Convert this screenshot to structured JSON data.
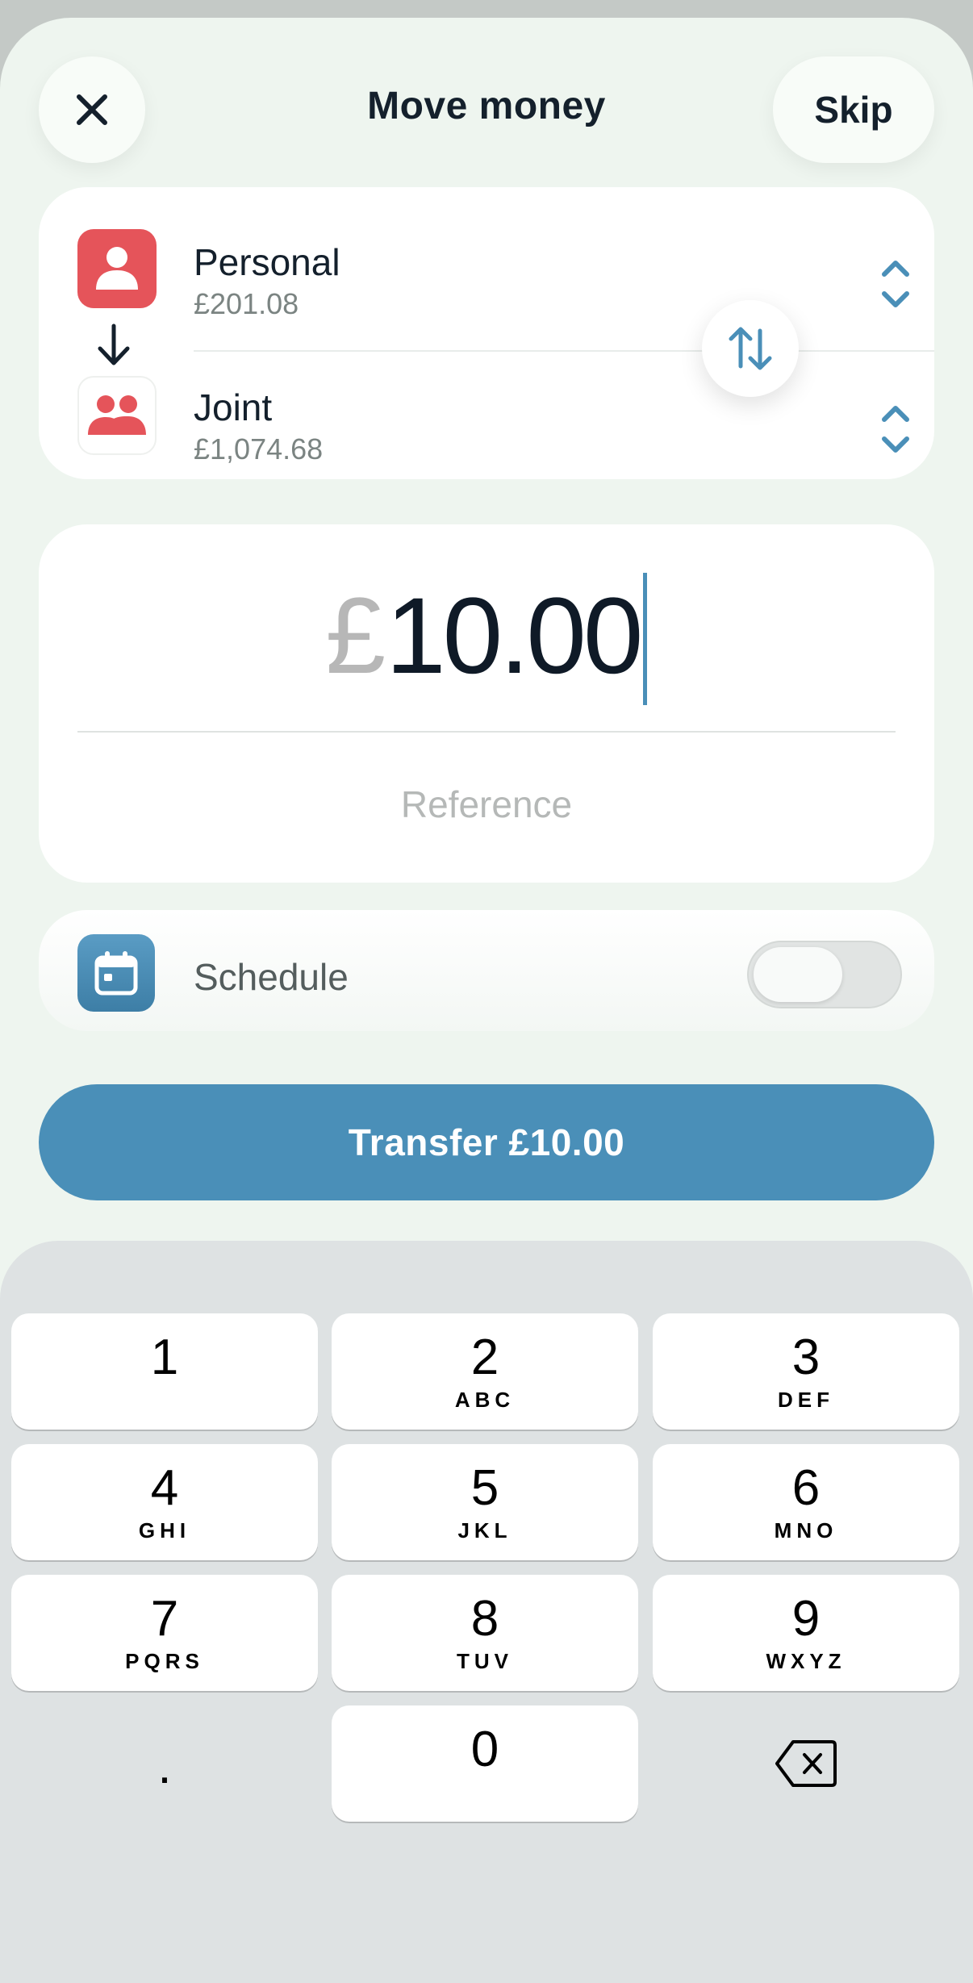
{
  "header": {
    "title": "Move money",
    "skip_label": "Skip",
    "close_icon": "close-icon"
  },
  "accounts": {
    "from": {
      "name": "Personal",
      "balance": "£201.08",
      "icon": "person-icon",
      "color": "#e5545a"
    },
    "to": {
      "name": "Joint",
      "balance": "£1,074.68",
      "icon": "people-icon",
      "color": "#e5545a"
    }
  },
  "amount": {
    "currency": "£",
    "value": "10.00"
  },
  "reference": {
    "placeholder": "Reference"
  },
  "schedule": {
    "label": "Schedule",
    "enabled": false
  },
  "transfer": {
    "label": "Transfer £10.00"
  },
  "keypad": {
    "keys": [
      {
        "num": "1",
        "sub": ""
      },
      {
        "num": "2",
        "sub": "ABC"
      },
      {
        "num": "3",
        "sub": "DEF"
      },
      {
        "num": "4",
        "sub": "GHI"
      },
      {
        "num": "5",
        "sub": "JKL"
      },
      {
        "num": "6",
        "sub": "MNO"
      },
      {
        "num": "7",
        "sub": "PQRS"
      },
      {
        "num": "8",
        "sub": "TUV"
      },
      {
        "num": "9",
        "sub": "WXYZ"
      }
    ],
    "dot": ".",
    "zero": "0"
  },
  "colors": {
    "accent": "#4a8fb8",
    "background": "#eef5ef",
    "keypad_bg": "#dee2e3"
  }
}
